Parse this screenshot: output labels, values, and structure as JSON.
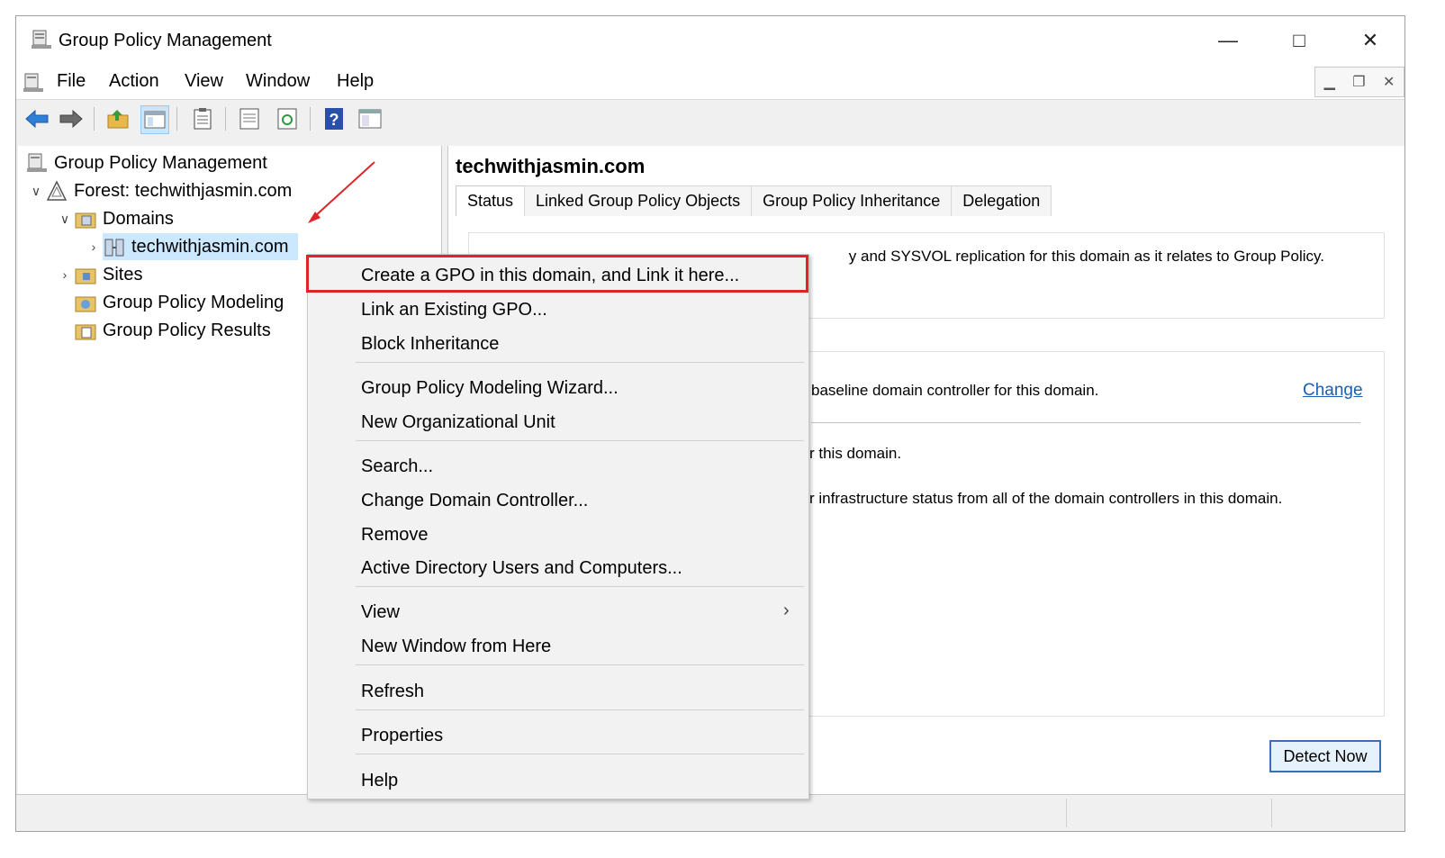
{
  "window": {
    "title": "Group Policy Management",
    "controls": {
      "minimize": "—",
      "maximize": "□",
      "close": "✕"
    }
  },
  "menubar": {
    "items": [
      "File",
      "Action",
      "View",
      "Window",
      "Help"
    ]
  },
  "toolbar": {
    "icons": [
      "back-arrow-icon",
      "forward-arrow-icon",
      "up-folder-icon",
      "show-hide-tree-icon",
      "clipboard-icon",
      "properties-icon",
      "refresh-icon",
      "help-icon",
      "console-icon"
    ]
  },
  "tree": {
    "root": "Group Policy Management",
    "forest": "Forest: techwithjasmin.com",
    "domains": "Domains",
    "domain": "techwithjasmin.com",
    "sites": "Sites",
    "modeling": "Group Policy Modeling",
    "results": "Group Policy Results"
  },
  "right_pane": {
    "title": "techwithjasmin.com",
    "tabs": [
      "Status",
      "Linked Group Policy Objects",
      "Group Policy Inheritance",
      "Delegation"
    ],
    "active_tab": "Status",
    "line1": "y and SYSVOL replication for this domain as it relates to Group Policy.",
    "line2": "baseline domain controller for this domain.",
    "change_link": "Change",
    "line3": "r this domain.",
    "line4": "r infrastructure status from all of the domain controllers in this domain.",
    "detect_button": "Detect Now"
  },
  "context_menu": {
    "items": [
      "Create a GPO in this domain, and Link it here...",
      "Link an Existing GPO...",
      "Block Inheritance",
      "Group Policy Modeling Wizard...",
      "New Organizational Unit",
      "Search...",
      "Change Domain Controller...",
      "Remove",
      "Active Directory Users and Computers...",
      "View",
      "New Window from Here",
      "Refresh",
      "Properties",
      "Help"
    ],
    "submenu_arrow": "›"
  },
  "colors": {
    "highlight_border": "#e0232a",
    "arrow": "#e0232a",
    "selection": "#cce8ff",
    "link": "#1a5fb4"
  }
}
